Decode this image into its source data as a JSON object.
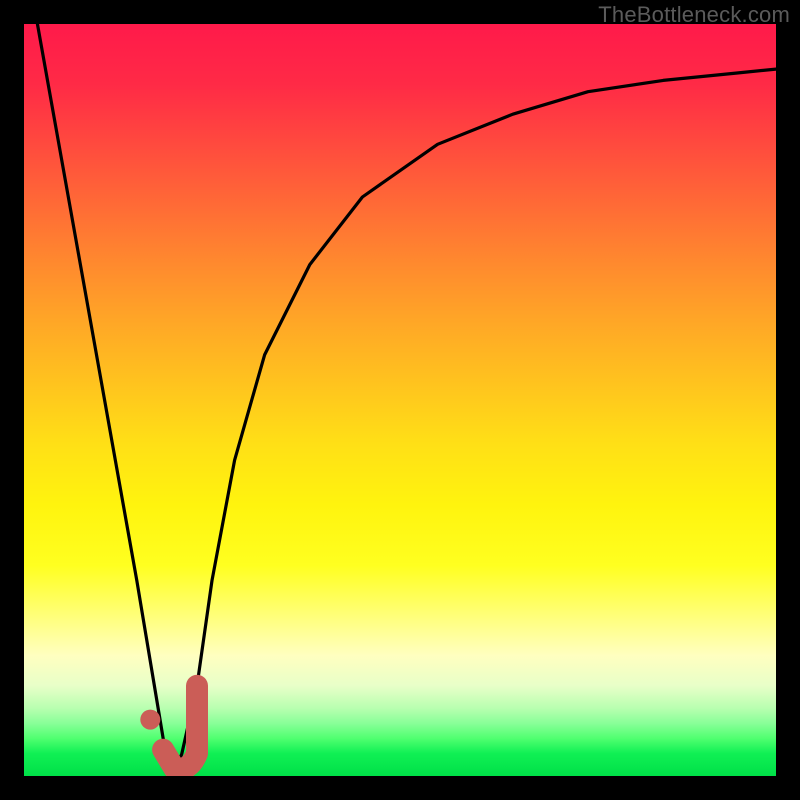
{
  "watermark": "TheBottleneck.com",
  "colors": {
    "background": "#000000",
    "curve": "#000000",
    "accent": "#cb5d57",
    "gradient_top": "#ff1a4a",
    "gradient_bottom": "#00e048"
  },
  "chart_data": {
    "type": "line",
    "title": "",
    "xlabel": "",
    "ylabel": "",
    "xlim": [
      0,
      100
    ],
    "ylim": [
      0,
      100
    ],
    "grid": false,
    "legend": false,
    "series": [
      {
        "name": "bottleneck-curve",
        "x": [
          0,
          5,
          10,
          15,
          18,
          19,
          20,
          21,
          23,
          25,
          28,
          32,
          38,
          45,
          55,
          65,
          75,
          85,
          95,
          100
        ],
        "values": [
          110,
          82,
          54,
          26,
          8,
          2,
          0,
          3,
          12,
          26,
          42,
          56,
          68,
          77,
          84,
          88,
          91,
          92.5,
          93.5,
          94
        ]
      }
    ],
    "annotations": [
      {
        "name": "accent-j-mark",
        "x": 20,
        "y": 2
      }
    ]
  }
}
